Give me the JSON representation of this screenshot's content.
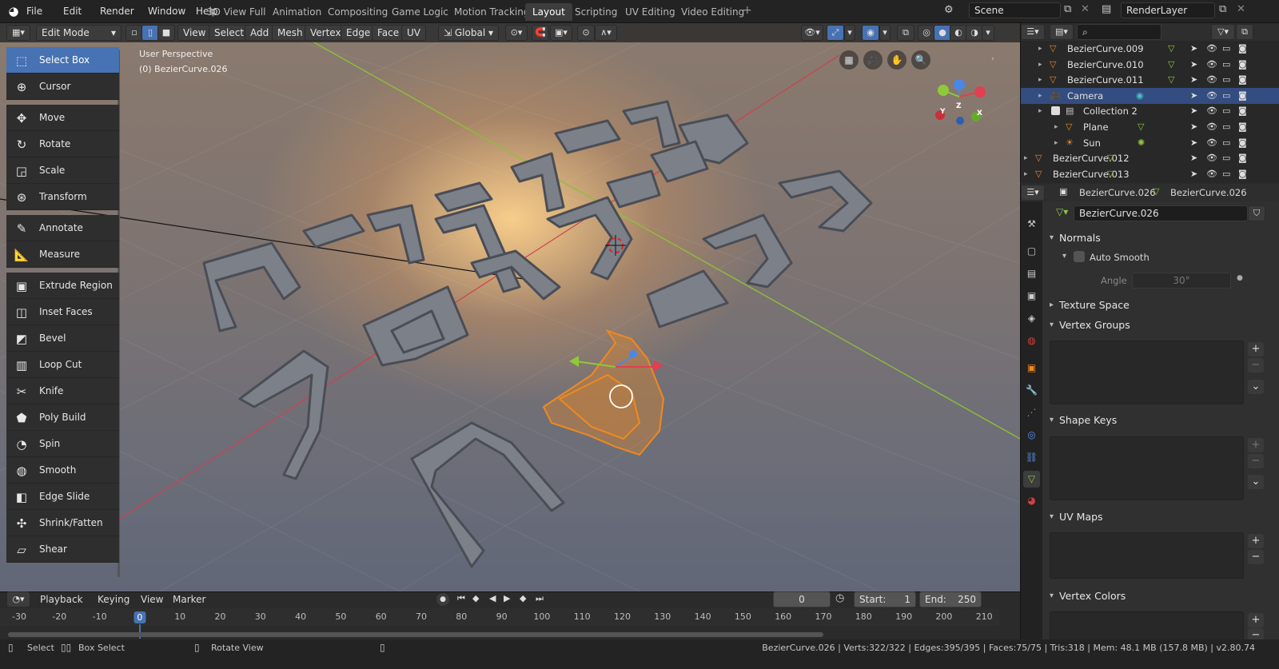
{
  "topbar": {
    "menus": [
      "File",
      "Edit",
      "Render",
      "Window",
      "Help"
    ],
    "workspaces": [
      "3D View Full",
      "Animation",
      "Compositing",
      "Game Logic",
      "Motion Tracking",
      "Layout",
      "Scripting",
      "UV Editing",
      "Video Editing"
    ],
    "active_workspace": "Layout",
    "scene": "Scene",
    "view_layer": "RenderLayer"
  },
  "viewport_header": {
    "mode": "Edit Mode",
    "menus": [
      "View",
      "Select",
      "Add",
      "Mesh",
      "Vertex",
      "Edge",
      "Face",
      "UV"
    ],
    "orientation": "Global"
  },
  "viewport": {
    "perspective_label": "User Perspective",
    "object_label": "(0) BezierCurve.026",
    "gizmo_axes": {
      "x": "X",
      "y": "Y",
      "z": "Z"
    }
  },
  "toolbar": {
    "tools": [
      {
        "label": "Select Box",
        "icon": "select-box-icon",
        "glyph": "⬚",
        "selected": true
      },
      {
        "label": "Cursor",
        "icon": "cursor-icon",
        "glyph": "⊕"
      },
      {
        "label": "Move",
        "icon": "move-icon",
        "glyph": "✥"
      },
      {
        "label": "Rotate",
        "icon": "rotate-icon",
        "glyph": "↻"
      },
      {
        "label": "Scale",
        "icon": "scale-icon",
        "glyph": "◲"
      },
      {
        "label": "Transform",
        "icon": "transform-icon",
        "glyph": "⊛"
      },
      {
        "label": "Annotate",
        "icon": "annotate-icon",
        "glyph": "✎"
      },
      {
        "label": "Measure",
        "icon": "measure-icon",
        "glyph": "📐"
      },
      {
        "label": "Extrude Region",
        "icon": "extrude-icon",
        "glyph": "▣"
      },
      {
        "label": "Inset Faces",
        "icon": "inset-icon",
        "glyph": "◫"
      },
      {
        "label": "Bevel",
        "icon": "bevel-icon",
        "glyph": "◩"
      },
      {
        "label": "Loop Cut",
        "icon": "loop-cut-icon",
        "glyph": "▥"
      },
      {
        "label": "Knife",
        "icon": "knife-icon",
        "glyph": "✂"
      },
      {
        "label": "Poly Build",
        "icon": "poly-build-icon",
        "glyph": "⬟"
      },
      {
        "label": "Spin",
        "icon": "spin-icon",
        "glyph": "◔"
      },
      {
        "label": "Smooth",
        "icon": "smooth-icon",
        "glyph": "◍"
      },
      {
        "label": "Edge Slide",
        "icon": "edge-slide-icon",
        "glyph": "◧"
      },
      {
        "label": "Shrink/Fatten",
        "icon": "shrink-fatten-icon",
        "glyph": "✣"
      },
      {
        "label": "Shear",
        "icon": "shear-icon",
        "glyph": "▱"
      }
    ]
  },
  "outliner": {
    "search_placeholder": "",
    "rows": [
      {
        "label": "BezierCurve.009",
        "icon": "curve-icon",
        "selected": false
      },
      {
        "label": "BezierCurve.010",
        "icon": "curve-icon",
        "selected": false
      },
      {
        "label": "BezierCurve.011",
        "icon": "curve-icon",
        "selected": false
      },
      {
        "label": "Camera",
        "icon": "camera-icon",
        "selected": true
      },
      {
        "label": "Collection 2",
        "icon": "collection-icon",
        "selected": false
      },
      {
        "label": "Plane",
        "icon": "mesh-icon",
        "selected": false
      },
      {
        "label": "Sun",
        "icon": "light-icon",
        "selected": false
      },
      {
        "label": "BezierCurve.012",
        "icon": "curve-icon",
        "selected": false
      },
      {
        "label": "BezierCurve.013",
        "icon": "curve-icon",
        "selected": false
      }
    ]
  },
  "properties": {
    "object_name": "BezierCurve.026",
    "data_name": "BezierCurve.026",
    "mesh_field": "BezierCurve.026",
    "panels": {
      "normals": "Normals",
      "auto_smooth": "Auto Smooth",
      "angle_label": "Angle",
      "angle_value": "30°",
      "texture_space": "Texture Space",
      "vertex_groups": "Vertex Groups",
      "shape_keys": "Shape Keys",
      "uv_maps": "UV Maps",
      "vertex_colors": "Vertex Colors"
    }
  },
  "timeline": {
    "menus": [
      "Playback",
      "Keying",
      "View",
      "Marker"
    ],
    "current_frame": "0",
    "start_label": "Start:",
    "start": "1",
    "end_label": "End:",
    "end": "250",
    "ticks": [
      "-30",
      "-20",
      "-10",
      "0",
      "10",
      "20",
      "30",
      "40",
      "50",
      "60",
      "70",
      "80",
      "90",
      "100",
      "110",
      "120",
      "130",
      "140",
      "150",
      "160",
      "170",
      "180",
      "190",
      "200",
      "210"
    ],
    "tick_values": [
      -30,
      -20,
      -10,
      0,
      10,
      20,
      30,
      40,
      50,
      60,
      70,
      80,
      90,
      100,
      110,
      120,
      130,
      140,
      150,
      160,
      170,
      180,
      190,
      200,
      210
    ]
  },
  "statusbar": {
    "select": "Select",
    "box_select": "Box Select",
    "rotate_view": "Rotate View",
    "stats": "BezierCurve.026 | Verts:322/322 | Edges:395/395 | Faces:75/75 | Tris:318 | Mem: 48.1 MB (157.8 MB) | v2.80.74"
  },
  "colors": {
    "accent": "#4772b3",
    "selected_object": "#f0891f",
    "x_axis": "#e04050",
    "y_axis": "#8fc93a",
    "z_axis": "#4a88e8"
  }
}
